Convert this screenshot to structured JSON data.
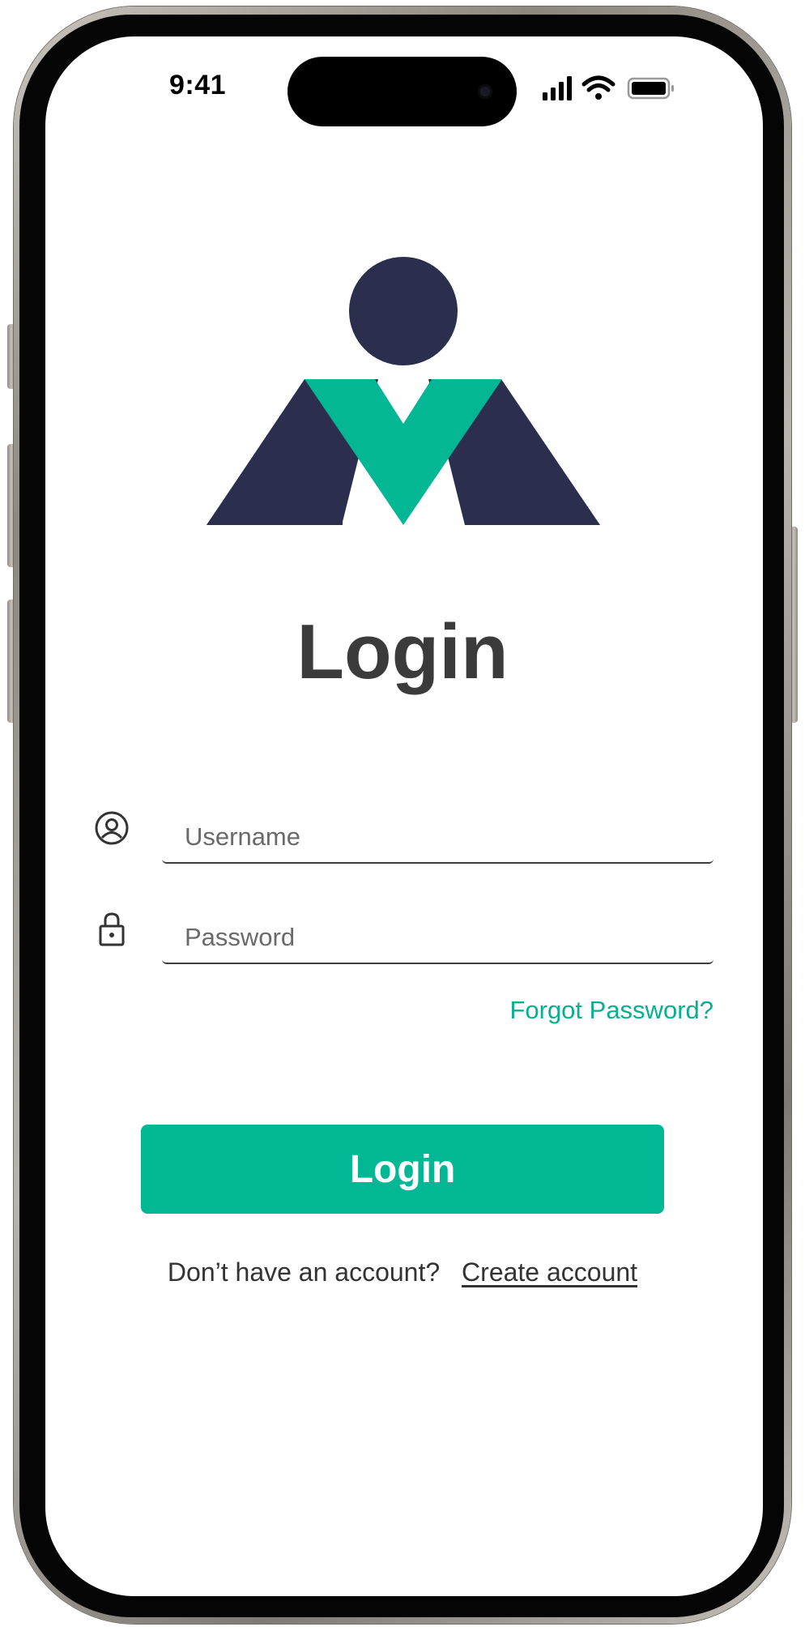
{
  "status_bar": {
    "time": "9:41",
    "icons": [
      "cellular-signal-icon",
      "wifi-icon",
      "battery-icon"
    ]
  },
  "brand": {
    "logo_icon": "person-v-logo",
    "colors": {
      "navy": "#2b2e4d",
      "teal": "#03b795"
    }
  },
  "login": {
    "title": "Login",
    "username": {
      "icon": "user-circle-icon",
      "placeholder": "Username",
      "value": ""
    },
    "password": {
      "icon": "lock-icon",
      "placeholder": "Password",
      "value": ""
    },
    "forgot_password": "Forgot Password?",
    "submit_label": "Login",
    "signup_prompt": "Don’t have an account?",
    "signup_link": "Create account"
  },
  "theme": {
    "accent": "#02b794",
    "text": "#3b3b3b",
    "background": "#ffffff"
  }
}
